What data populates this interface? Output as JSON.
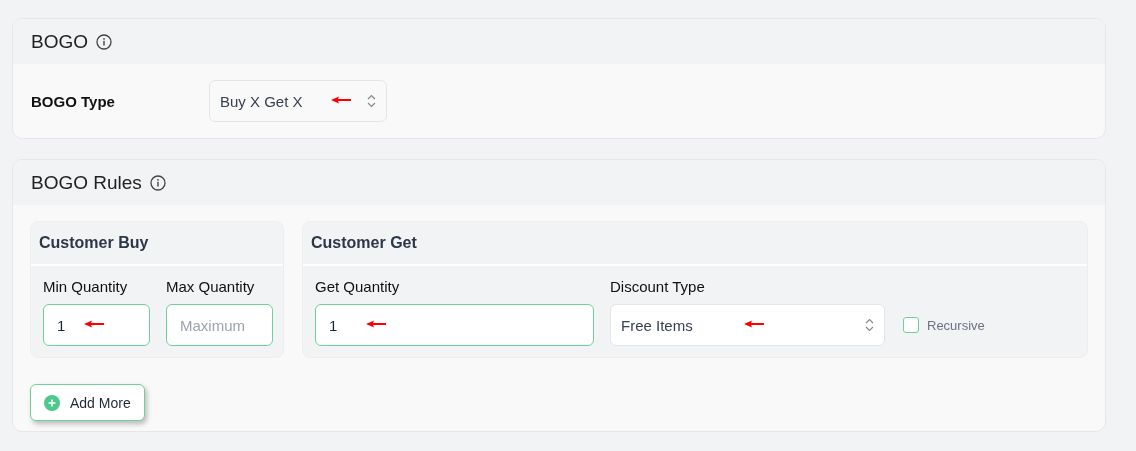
{
  "bogo_card": {
    "title": "BOGO",
    "type_label": "BOGO Type",
    "type_select": {
      "value": "Buy X Get X",
      "annotated": true
    }
  },
  "rules_card": {
    "title": "BOGO Rules",
    "customer_buy": {
      "title": "Customer Buy",
      "fields": [
        {
          "label": "Min Quantity",
          "value": "1",
          "annotated": true
        },
        {
          "label": "Max Quantity",
          "placeholder": "Maximum",
          "annotated": false
        }
      ]
    },
    "customer_get": {
      "title": "Customer Get",
      "quantity": {
        "label": "Get Quantity",
        "value": "1",
        "annotated": true
      },
      "discount": {
        "label": "Discount Type",
        "value": "Free Items",
        "annotated": true
      },
      "recursive": {
        "label": "Recursive",
        "checked": false
      }
    },
    "add_button": "Add More"
  }
}
